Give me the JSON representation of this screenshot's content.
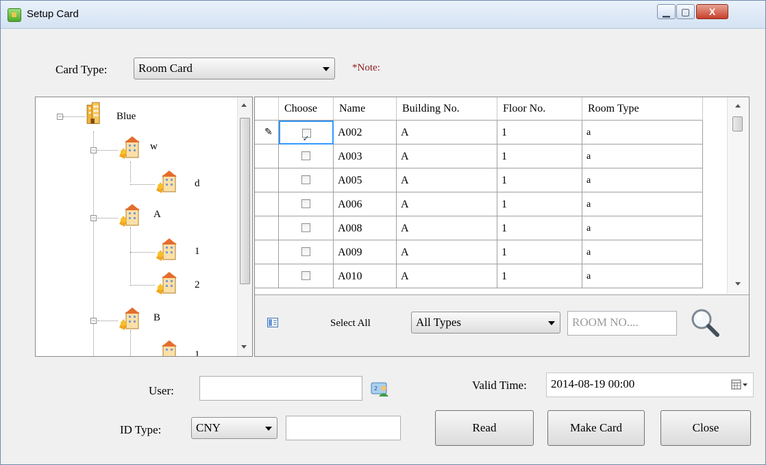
{
  "window": {
    "title": "Setup Card",
    "controls": {
      "minimize": "▁",
      "maximize": "▢",
      "close": "X"
    }
  },
  "card_type": {
    "label": "Card Type:",
    "value": "Room Card",
    "note": "*Note:"
  },
  "tree": {
    "nodes": [
      {
        "label": "Blue",
        "icon": "building-icon"
      },
      {
        "label": "w",
        "icon": "building-icon"
      },
      {
        "label": "d",
        "icon": "building-icon"
      },
      {
        "label": "A",
        "icon": "building-icon"
      },
      {
        "label": "1",
        "icon": "building-icon"
      },
      {
        "label": "2",
        "icon": "building-icon"
      },
      {
        "label": "B",
        "icon": "building-icon"
      },
      {
        "label": "1",
        "icon": "building-icon"
      }
    ]
  },
  "grid": {
    "columns": [
      "Choose",
      "Name",
      "Building No.",
      "Floor No.",
      "Room Type"
    ],
    "rows": [
      {
        "checked": true,
        "name": "A002",
        "building": "A",
        "floor": "1",
        "room_type": "a"
      },
      {
        "checked": false,
        "name": "A003",
        "building": "A",
        "floor": "1",
        "room_type": "a"
      },
      {
        "checked": false,
        "name": "A005",
        "building": "A",
        "floor": "1",
        "room_type": "a"
      },
      {
        "checked": false,
        "name": "A006",
        "building": "A",
        "floor": "1",
        "room_type": "a"
      },
      {
        "checked": false,
        "name": "A008",
        "building": "A",
        "floor": "1",
        "room_type": "a"
      },
      {
        "checked": false,
        "name": "A009",
        "building": "A",
        "floor": "1",
        "room_type": "a"
      },
      {
        "checked": false,
        "name": "A010",
        "building": "A",
        "floor": "1",
        "room_type": "a"
      }
    ]
  },
  "filter": {
    "select_all": "Select All",
    "type_value": "All Types",
    "room_placeholder": "ROOM NO...."
  },
  "user": {
    "label": "User:",
    "value": ""
  },
  "id_type": {
    "label": "ID Type:",
    "value": "CNY",
    "number": ""
  },
  "valid_time": {
    "label": "Valid Time:",
    "value": "2014-08-19 00:00"
  },
  "buttons": {
    "read": "Read",
    "make_card": "Make Card",
    "close": "Close"
  }
}
